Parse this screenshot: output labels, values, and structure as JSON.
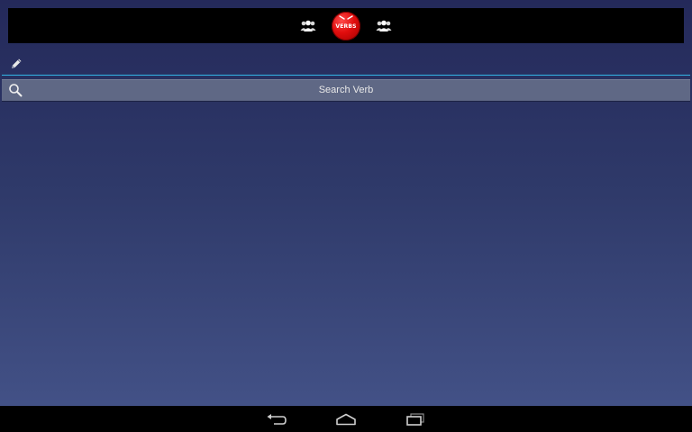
{
  "header": {
    "logo_text": "VERBS",
    "left_icon": "group-icon",
    "right_icon": "group-icon"
  },
  "verb_input": {
    "value": "",
    "placeholder": "",
    "icon": "pencil-icon",
    "accent_color": "#33b5e5"
  },
  "search_button": {
    "label": "Search Verb",
    "icon": "search-icon"
  },
  "nav_bar": {
    "back_icon": "back-icon",
    "home_icon": "home-icon",
    "recents_icon": "recent-apps-icon"
  },
  "colors": {
    "logo_red": "#e10d0d",
    "background_top": "#24295a",
    "background_bottom": "#45548a"
  }
}
